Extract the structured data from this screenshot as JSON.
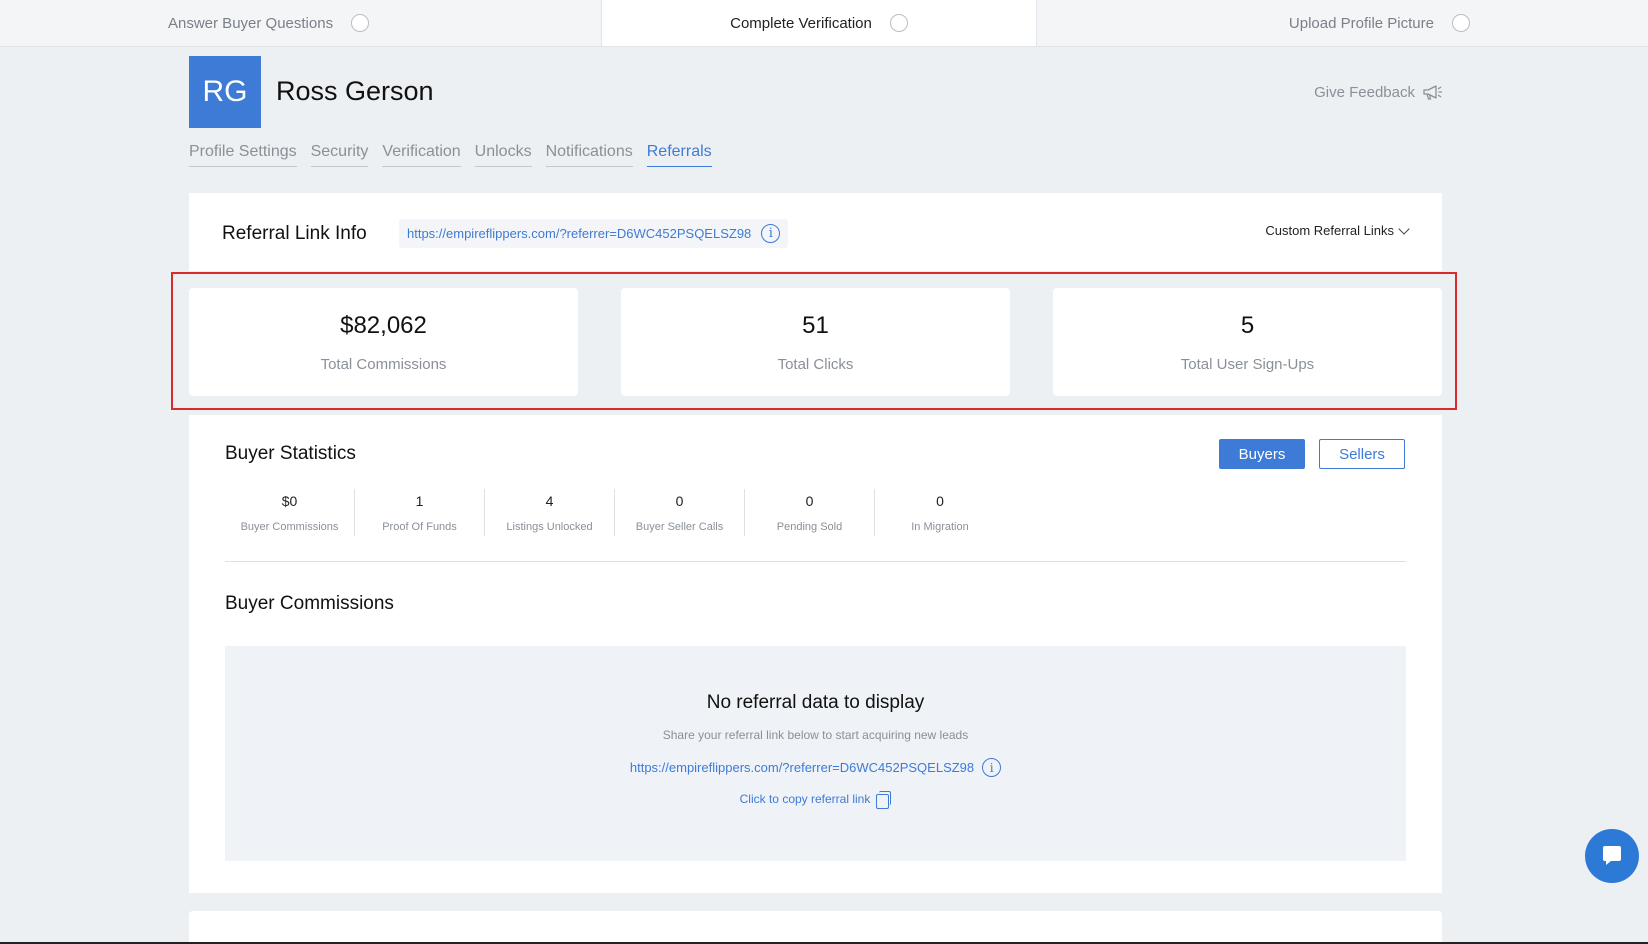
{
  "progress_steps": [
    {
      "label": "Answer Buyer Questions"
    },
    {
      "label": "Complete Verification"
    },
    {
      "label": "Upload Profile Picture"
    }
  ],
  "profile": {
    "initials": "RG",
    "name": "Ross Gerson",
    "feedback_label": "Give Feedback"
  },
  "tabs": [
    {
      "label": "Profile Settings"
    },
    {
      "label": "Security"
    },
    {
      "label": "Verification"
    },
    {
      "label": "Unlocks"
    },
    {
      "label": "Notifications"
    },
    {
      "label": "Referrals"
    }
  ],
  "active_tab": "Referrals",
  "referral_info": {
    "title": "Referral Link Info",
    "url": "https://empireflippers.com/?referrer=D6WC452PSQELSZ98",
    "custom_links_label": "Custom Referral Links"
  },
  "stats": [
    {
      "value": "$82,062",
      "label": "Total Commissions"
    },
    {
      "value": "51",
      "label": "Total Clicks"
    },
    {
      "value": "5",
      "label": "Total User Sign-Ups"
    }
  ],
  "buyer_statistics": {
    "title": "Buyer Statistics",
    "buyers_button": "Buyers",
    "sellers_button": "Sellers",
    "items": [
      {
        "value": "$0",
        "label": "Buyer Commissions"
      },
      {
        "value": "1",
        "label": "Proof Of Funds"
      },
      {
        "value": "4",
        "label": "Listings Unlocked"
      },
      {
        "value": "0",
        "label": "Buyer Seller Calls"
      },
      {
        "value": "0",
        "label": "Pending Sold"
      },
      {
        "value": "0",
        "label": "In Migration"
      }
    ]
  },
  "buyer_commissions": {
    "title": "Buyer Commissions",
    "empty_title": "No referral data to display",
    "empty_subtitle": "Share your referral link below to start acquiring new leads",
    "url": "https://empireflippers.com/?referrer=D6WC452PSQELSZ98",
    "copy_label": "Click to copy referral link"
  },
  "colors": {
    "accent": "#3e7bd6",
    "highlight": "#d92b2b",
    "background": "#edf0f3"
  }
}
